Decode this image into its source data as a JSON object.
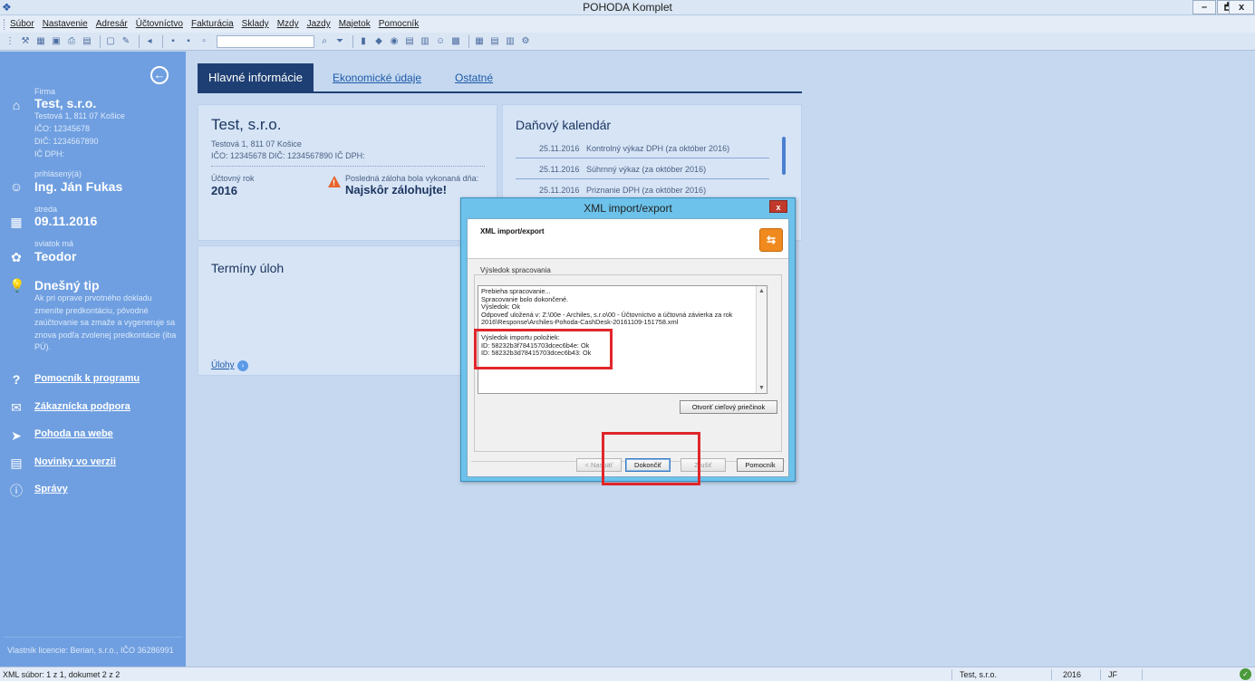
{
  "window": {
    "title": "POHODA Komplet",
    "minimize": "–",
    "maximize": "🗗",
    "close": "x"
  },
  "menu": [
    "Súbor",
    "Nastavenie",
    "Adresár",
    "Účtovníctvo",
    "Fakturácia",
    "Sklady",
    "Mzdy",
    "Jazdy",
    "Majetok",
    "Pomocník"
  ],
  "sidebar": {
    "firma_label": "Firma",
    "firma_name": "Test, s.r.o.",
    "firma_address": "Testová 1, 811 07 Košice",
    "firma_ico": "IČO: 12345678",
    "firma_dic": "DIČ: 1234567890",
    "firma_icdph": "IČ DPH:",
    "user_label": "prihlásený(á)",
    "user_name": "Ing. Ján Fukas",
    "day_label": "streda",
    "date": "09.11.2016",
    "nameday_label": "sviatok má",
    "nameday": "Teodor",
    "tip_title": "Dnešný tip",
    "tip_text": "Ak pri oprave prvotného dokladu zmeníte predkontáciu, pôvodné zaúčtovanie sa zmaže a vygeneruje sa znova podľa zvolenej predkontácie (iba PÚ).",
    "links": [
      "Pomocník k programu",
      "Zákaznícka podpora",
      "Pohoda na webe",
      "Novinky vo verzii",
      "Správy"
    ],
    "footer": "Vlastník licencie: Berian, s.r.o., IČO 36286991"
  },
  "tabs": {
    "active": "Hlavné informácie",
    "ekonomicke": "Ekonomické údaje",
    "ostatne": "Ostatné"
  },
  "company_card": {
    "name": "Test, s.r.o.",
    "address": "Testová 1, 811 07 Košice",
    "ids": "IČO: 12345678   DIČ: 1234567890   IČ DPH:",
    "year_label": "Účtovný rok",
    "year": "2016",
    "backup_label": "Posledná záloha bola vykonaná dňa:",
    "backup_value": "Najskôr zálohujte!"
  },
  "tasks_card": {
    "title": "Termíny úloh",
    "link": "Úlohy"
  },
  "tax_card": {
    "title": "Daňový kalendár",
    "rows": [
      {
        "date": "25.11.2016",
        "desc": "Kontrolný výkaz DPH (za október 2016)"
      },
      {
        "date": "25.11.2016",
        "desc": "Súhrnný výkaz (za október 2016)"
      },
      {
        "date": "25.11.2016",
        "desc": "Priznanie DPH (za október 2016)"
      }
    ]
  },
  "dialog": {
    "title": "XML import/export",
    "close": "x",
    "header": "XML import/export",
    "section": "Výsledok spracovania",
    "lines": [
      "Prebieha spracovanie...",
      "Spracovanie bolo dokončené.",
      "Výsledok: Ok",
      "Odpoveď uložená v: Z:\\00e - Archiles, s.r.o\\00 - Účtovníctvo a účtovná závierka za rok",
      "2016\\Response\\Archiles-Pohoda-CashDesk-20161109-151758.xml",
      "",
      "Výsledok importu položiek:",
      "ID: 58232b3f78415703dcec6b4e: Ok",
      "ID: 58232b3d78415703dcec6b43: Ok"
    ],
    "open_folder": "Otvoriť cieľový priečinok",
    "btn_back": "< Naspäť",
    "btn_finish": "Dokončiť",
    "btn_cancel": "Zrušiť",
    "btn_help": "Pomocník"
  },
  "status": {
    "left": "XML súbor: 1 z 1, dokumet 2 z 2",
    "company": "Test, s.r.o.",
    "year": "2016",
    "user": "JF"
  },
  "colors": {
    "sidebar": "#6f9fe0",
    "tab_active": "#1e3f73",
    "dialog_frame": "#6cc2ea",
    "highlight": "#e0262b"
  }
}
